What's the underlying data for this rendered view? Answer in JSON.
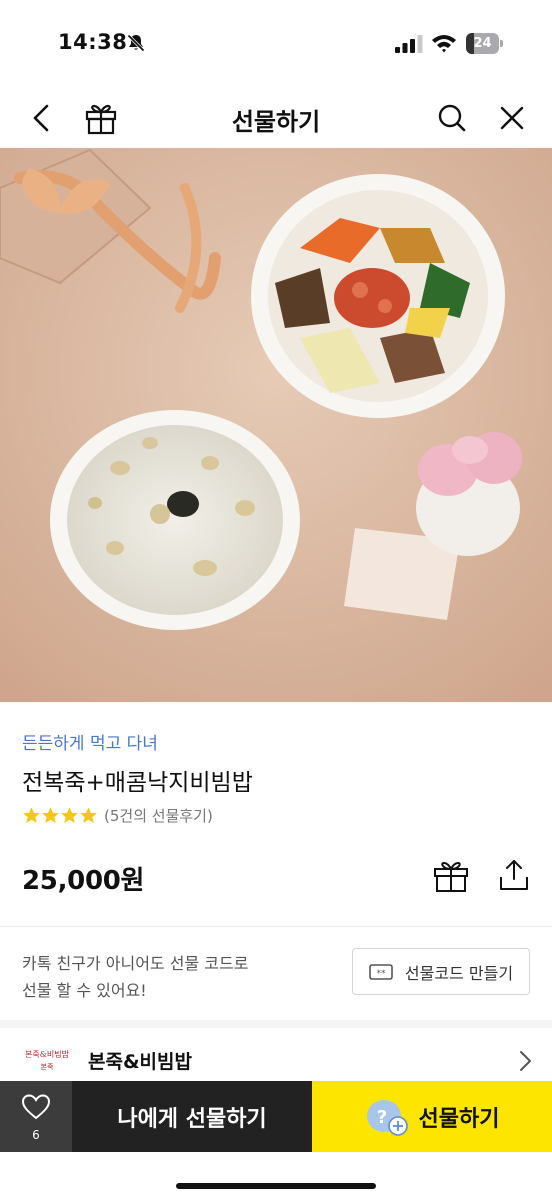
{
  "status_bar": {
    "time": "14:38",
    "battery": "24",
    "battery_level": 0.24,
    "icons": [
      "bell-slash-icon",
      "cellular-signal-icon",
      "wifi-icon",
      "battery-icon"
    ]
  },
  "nav": {
    "title": "선물하기",
    "icons": [
      "back-chevron-icon",
      "gift-icon",
      "search-icon",
      "close-icon"
    ]
  },
  "product": {
    "tagline": "든든하게 먹고 다녀",
    "name": "전복죽+매콤낙지비빔밥",
    "rating_stars": 4,
    "review_count": "(5건의 선물후기)",
    "price": "25,000원",
    "tagline_color": "#4a77c9",
    "star_color": "#f5c518"
  },
  "gift_code": {
    "description_line1": "카톡 친구가 아니어도 선물 코드로",
    "description_line2": "선물 할 수 있어요!",
    "button_label": "선물코드 만들기"
  },
  "brand": {
    "name": "본죽&비빔밥",
    "logo_text_line1": "본죽&비빔밥",
    "logo_text_line2": "본죽",
    "logo_color": "#b3262e"
  },
  "bottom_bar": {
    "like_count": "6",
    "gift_to_me_label": "나에게 선물하기",
    "gift_label": "선물하기",
    "gift_button_color": "#fee500",
    "gift_to_me_color": "#222222"
  }
}
